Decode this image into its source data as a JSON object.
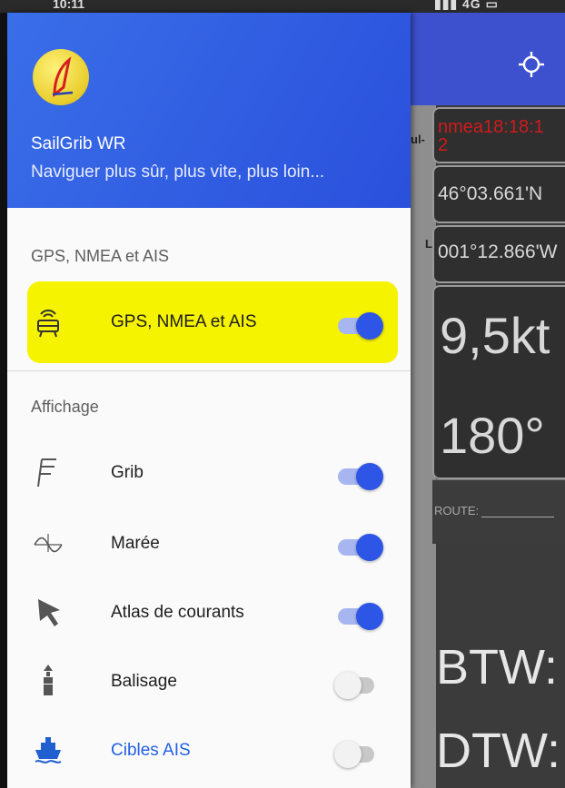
{
  "status_bar": {
    "time": "10:11",
    "icons": "▮▮▮ 4G ▭"
  },
  "app": {
    "name": "SailGrib WR",
    "tagline": "Naviguer plus sûr, plus vite, plus loin..."
  },
  "background": {
    "map_labels": [
      "ul-",
      "L"
    ],
    "nmea": "nmea18:18:1",
    "nmea_line2": "2",
    "lat": "46°03.661'N",
    "lon": "001°12.866'W",
    "speed": "9,5kt",
    "heading": "180°",
    "route": "ROUTE:",
    "btw": "BTW:",
    "dtw": "DTW:"
  },
  "sections": {
    "gps": "GPS, NMEA et AIS",
    "display": "Affichage"
  },
  "items": [
    {
      "label": "GPS, NMEA et AIS",
      "icon": "gps-antenna-icon",
      "enabled": true,
      "color": "#1e1e1e"
    },
    {
      "label": "Grib",
      "icon": "grib-flag-icon",
      "enabled": true,
      "color": "#1e1e1e"
    },
    {
      "label": "Marée",
      "icon": "tide-wave-icon",
      "enabled": true,
      "color": "#1e1e1e"
    },
    {
      "label": "Atlas de courants",
      "icon": "cursor-arrow-icon",
      "enabled": true,
      "color": "#1e1e1e"
    },
    {
      "label": "Balisage",
      "icon": "buoy-icon",
      "enabled": false,
      "color": "#1e1e1e"
    },
    {
      "label": "Cibles AIS",
      "icon": "ship-icon",
      "enabled": false,
      "color": "#2460e6"
    }
  ],
  "colors": {
    "header": "#2d5ae0",
    "accent": "#2d55e6",
    "highlight": "#f6f300",
    "appbar": "#3d51cf"
  }
}
